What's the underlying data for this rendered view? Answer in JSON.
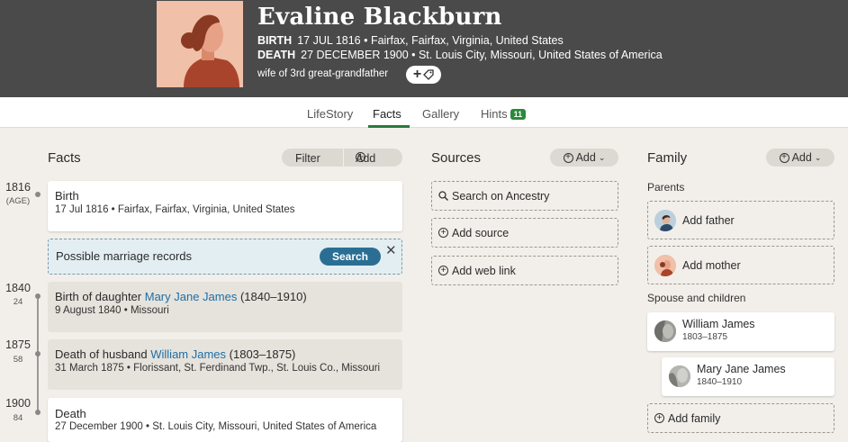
{
  "header": {
    "name": "Evaline Blackburn",
    "birth_label": "BIRTH",
    "birth_value": "17 JUL 1816 • Fairfax, Fairfax, Virginia, United States",
    "death_label": "DEATH",
    "death_value": "27 DECEMBER 1900 • St. Louis City, Missouri, United States of America",
    "relation": "wife of 3rd great-grandfather",
    "tag_button": "+"
  },
  "tabs": [
    {
      "label": "LifeStory"
    },
    {
      "label": "Facts"
    },
    {
      "label": "Gallery"
    },
    {
      "label": "Hints",
      "badge": "11"
    }
  ],
  "facts": {
    "title": "Facts",
    "filter_label": "Filter",
    "add_label": "Add",
    "timeline": [
      {
        "year": "1816",
        "age": "(AGE)"
      },
      {
        "year": "1840",
        "age": "24"
      },
      {
        "year": "1875",
        "age": "58"
      },
      {
        "year": "1900",
        "age": "84"
      }
    ],
    "birth": {
      "title": "Birth",
      "sub": "17 Jul 1816 • Fairfax, Fairfax, Virginia, United States"
    },
    "marriage": {
      "title": "Possible marriage records",
      "button": "Search"
    },
    "daughter": {
      "prefix": "Birth of daughter ",
      "link": "Mary Jane James",
      "range": " (1840–1910)",
      "sub": "9 August 1840 • Missouri"
    },
    "husband": {
      "prefix": "Death of husband ",
      "link": "William James",
      "range": " (1803–1875)",
      "sub": "31 March 1875 • Florissant, St. Ferdinand Twp., St. Louis Co., Missouri"
    },
    "death": {
      "title": "Death",
      "sub": "27 December 1900 • St. Louis City, Missouri, United States of America"
    }
  },
  "sources": {
    "title": "Sources",
    "add_label": "Add",
    "items": [
      "Search on Ancestry",
      "Add source",
      "Add web link"
    ]
  },
  "family": {
    "title": "Family",
    "add_label": "Add",
    "parents_label": "Parents",
    "add_father": "Add father",
    "add_mother": "Add mother",
    "spouse_label": "Spouse and children",
    "spouse": {
      "name": "William James",
      "dates": "1803–1875"
    },
    "child": {
      "name": "Mary Jane James",
      "dates": "1840–1910"
    },
    "add_family": "Add family"
  },
  "colors": {
    "header_bg": "#4a4a4a",
    "link": "#1d6fa5",
    "accent_green": "#2a8a3a",
    "search_btn": "#2a6f93"
  }
}
